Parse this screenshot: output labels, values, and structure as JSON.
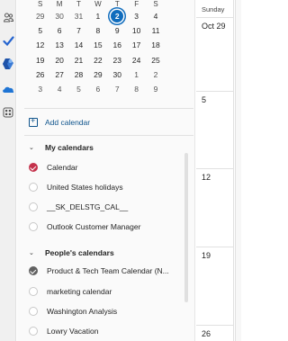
{
  "rail": [
    {
      "name": "people-icon"
    },
    {
      "name": "todo-check-icon"
    },
    {
      "name": "office-apps-icon"
    },
    {
      "name": "onedrive-cloud-icon"
    },
    {
      "name": "more-apps-icon"
    }
  ],
  "mini_calendar": {
    "weekdays": [
      "S",
      "M",
      "T",
      "W",
      "T",
      "F",
      "S"
    ],
    "weeks": [
      [
        "29",
        "30",
        "31",
        "1",
        "2",
        "3",
        "4"
      ],
      [
        "5",
        "6",
        "7",
        "8",
        "9",
        "10",
        "11"
      ],
      [
        "12",
        "13",
        "14",
        "15",
        "16",
        "17",
        "18"
      ],
      [
        "19",
        "20",
        "21",
        "22",
        "23",
        "24",
        "25"
      ],
      [
        "26",
        "27",
        "28",
        "29",
        "30",
        "1",
        "2"
      ],
      [
        "3",
        "4",
        "5",
        "6",
        "7",
        "8",
        "9"
      ]
    ],
    "today": "2",
    "accent": "#0f6cbd"
  },
  "add_calendar_label": "Add calendar",
  "my_calendars": {
    "label": "My calendars",
    "items": [
      {
        "label": "Calendar",
        "checked": true,
        "color": "#c4314b"
      },
      {
        "label": "United States holidays",
        "checked": false
      },
      {
        "label": "__SK_DELSTG_CAL__",
        "checked": false
      },
      {
        "label": "Outlook Customer Manager",
        "checked": false
      }
    ]
  },
  "peoples_calendars": {
    "label": "People's calendars",
    "items": [
      {
        "label": "Product & Tech Team Calendar (N...",
        "checked": true,
        "color": "#616161"
      },
      {
        "label": "marketing calendar",
        "checked": false
      },
      {
        "label": "Washington Analysis",
        "checked": false
      },
      {
        "label": "Lowry Vacation",
        "checked": false
      }
    ]
  },
  "grid": {
    "day_header": "Sunday",
    "dates": [
      "Oct 29",
      "5",
      "12",
      "19",
      "26"
    ]
  }
}
